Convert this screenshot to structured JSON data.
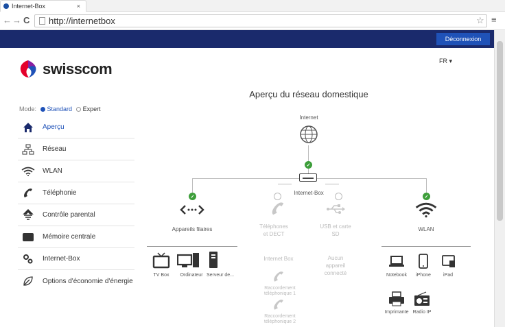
{
  "browser": {
    "tab_title": "Internet-Box",
    "tab_close": "×",
    "back": "←",
    "forward": "→",
    "reload": "C",
    "url": "http://internetbox",
    "star": "☆",
    "menu": "≡"
  },
  "header": {
    "logout_label": "Déconnexion",
    "logo_text": "swisscom",
    "language": "FR ▾"
  },
  "sidebar": {
    "mode_label": "Mode:",
    "mode_standard": "Standard",
    "mode_expert": "Expert",
    "items": [
      {
        "label": "Aperçu",
        "icon": "home-icon"
      },
      {
        "label": "Réseau",
        "icon": "network-icon"
      },
      {
        "label": "WLAN",
        "icon": "wifi-icon"
      },
      {
        "label": "Téléphonie",
        "icon": "phone-icon"
      },
      {
        "label": "Contrôle parental",
        "icon": "parental-control-icon"
      },
      {
        "label": "Mémoire centrale",
        "icon": "storage-icon"
      },
      {
        "label": "Internet-Box",
        "icon": "gears-icon"
      },
      {
        "label": "Options d'économie d'énergie",
        "icon": "leaf-icon"
      }
    ]
  },
  "main": {
    "title": "Aperçu du réseau domestique",
    "internet_label": "Internet",
    "box_label": "Internet-Box",
    "wired_label": "Appareils filaires",
    "phone_label": "Téléphones et DECT",
    "usb_label": "USB et carte SD",
    "wlan_label": "WLAN",
    "phone_sub": "Internet Box",
    "usb_sub": "Aucun appareil connecté",
    "handset1": "Raccordement téléphonique 1",
    "handset2": "Raccordement téléphonique 2",
    "wired_devices": [
      "TV Box",
      "Ordinateur",
      "Serveur de..."
    ],
    "wlan_devices": [
      "Notebook",
      "iPhone",
      "iPad",
      "Imprimante",
      "Radio IP"
    ]
  }
}
